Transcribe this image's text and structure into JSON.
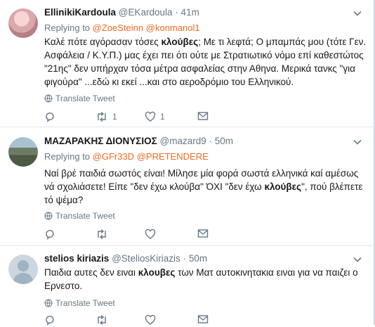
{
  "labels": {
    "replying_to": "Replying to",
    "translate_tweet": "Translate Tweet"
  },
  "tweets": [
    {
      "name": "EllinikiKardoula",
      "handle": "@EKardoula",
      "time": "· 41m",
      "mentions": [
        "@ZoeSteinn",
        "@konmanol1"
      ],
      "body": [
        "Καλέ πότε αγόρασαν τόσες ",
        "κλούβες",
        "; Με τι λεφτά; Ο μπαμπάς μου (τότε Γεν. Ασφάλεια / Κ.Υ.Π.) μας έχει πει ότι ούτε με Στρατιωτικό νόμο επί καθεστώτος \"21ης\" δεν υπήρχαν τόσα μέτρα ασφαλείας στην Αθηνα. Μερικά τανκς \"για φιγούρα\" ...εδώ κι εκεί ...και στο αεροδρόμιο του Ελληνικού."
      ],
      "retweets": "1",
      "likes": "1"
    },
    {
      "name": "ΜΑΖΑΡΑΚΗΣ ΔΙΟΝΥΣΙΟΣ",
      "handle": "@mazard9",
      "time": "· 50m",
      "mentions": [
        "@GFr33D",
        "@PRETENDERE"
      ],
      "body": [
        "Ναί βρέ παιδιά σωστός είναι! Μίλησε μία φορά σωστά ελληνικά καί αμέσως νά σχολιάσετε! Είπε \"δεν  έχω κλούβα\" ΌΧΙ \"δεν έχω ",
        "κλούβες",
        "\", πού βλέπετε τό ψέμα?"
      ],
      "retweets": "",
      "likes": ""
    },
    {
      "name": "stelios kiriazis",
      "handle": "@SteliosKiriazis",
      "time": "· 50m",
      "mentions": [],
      "body": [
        "Παιδια αυτες δεν ειναι ",
        "κλουβες",
        " των Ματ αυτοκινητακια ειναι για να παιζει ο Ερνεστο."
      ],
      "retweets": "",
      "likes": ""
    }
  ]
}
